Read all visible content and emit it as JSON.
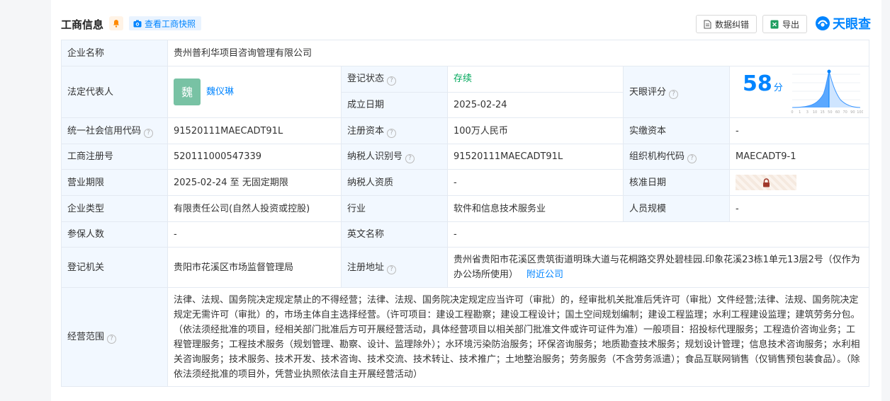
{
  "header": {
    "title": "工商信息",
    "snapshot_label": "查看工商快照",
    "fix_label": "数据纠错",
    "export_label": "导出",
    "logo_text": "天眼查"
  },
  "company": {
    "name_label": "企业名称",
    "name": "贵州普利华项目咨询管理有限公司",
    "legal_rep_label": "法定代表人",
    "legal_rep_avatar": "魏",
    "legal_rep": "魏仪琳",
    "reg_status_label": "登记状态",
    "reg_status": "存续",
    "est_date_label": "成立日期",
    "est_date": "2025-02-24",
    "score_label": "天眼评分",
    "score": "58",
    "score_unit": "分",
    "credit_code_label": "统一社会信用代码",
    "credit_code": "91520111MAECADT91L",
    "reg_capital_label": "注册资本",
    "reg_capital": "100万人民币",
    "paid_capital_label": "实缴资本",
    "paid_capital": "-",
    "reg_no_label": "工商注册号",
    "reg_no": "520111000547339",
    "taxpayer_id_label": "纳税人识别号",
    "taxpayer_id": "91520111MAECADT91L",
    "org_code_label": "组织机构代码",
    "org_code": "MAECADT9-1",
    "term_label": "营业期限",
    "term": "2025-02-24 至 无固定期限",
    "taxpayer_qual_label": "纳税人资质",
    "taxpayer_qual": "-",
    "approve_date_label": "核准日期",
    "type_label": "企业类型",
    "type": "有限责任公司(自然人投资或控股)",
    "industry_label": "行业",
    "industry": "软件和信息技术服务业",
    "staff_label": "人员规模",
    "staff": "-",
    "insured_label": "参保人数",
    "insured": "-",
    "en_name_label": "英文名称",
    "en_name": "-",
    "authority_label": "登记机关",
    "authority": "贵阳市花溪区市场监督管理局",
    "address_label": "注册地址",
    "address": "贵州省贵阳市花溪区贵筑街道明珠大道与花桐路交界处碧桂园.印象花溪23栋1单元13层2号（仅作为办公场所使用）",
    "nearby_label": "附近公司",
    "scope_label": "经营范围",
    "scope": "法律、法规、国务院决定规定禁止的不得经营；法律、法规、国务院决定规定应当许可（审批）的，经审批机关批准后凭许可（审批）文件经营;法律、法规、国务院决定规定无需许可（审批）的，市场主体自主选择经营。（许可项目：建设工程勘察；建设工程设计；国土空间规划编制；建设工程监理；水利工程建设监理；建筑劳务分包。（依法须经批准的项目，经相关部门批准后方可开展经营活动，具体经营项目以相关部门批准文件或许可证件为准）一般项目：招投标代理服务；工程造价咨询业务；工程管理服务；工程技术服务（规划管理、勘察、设计、监理除外）；水环境污染防治服务；环保咨询服务；地质勘查技术服务；规划设计管理；信息技术咨询服务；水利相关咨询服务；技术服务、技术开发、技术咨询、技术交流、技术转让、技术推广；土地整治服务；劳务服务（不含劳务派遣）；食品互联网销售（仅销售预包装食品）。（除依法须经批准的项目外，凭营业执照依法自主开展经营活动）"
  },
  "score_chart": {
    "ticks": [
      "0",
      "1",
      "3",
      "10",
      "15",
      "50",
      "60",
      "70",
      "90",
      "100"
    ],
    "accent": "#0084ff"
  },
  "icons": {
    "bell": "bell-icon",
    "camera": "camera-icon",
    "document": "document-icon",
    "excel": "excel-icon",
    "lock": "lock-icon",
    "help": "help-icon"
  },
  "colors": {
    "accent": "#0084ff",
    "status_green": "#00a85b",
    "label_bg": "#f2f8ff",
    "avatar_bg": "#78c2a4"
  }
}
